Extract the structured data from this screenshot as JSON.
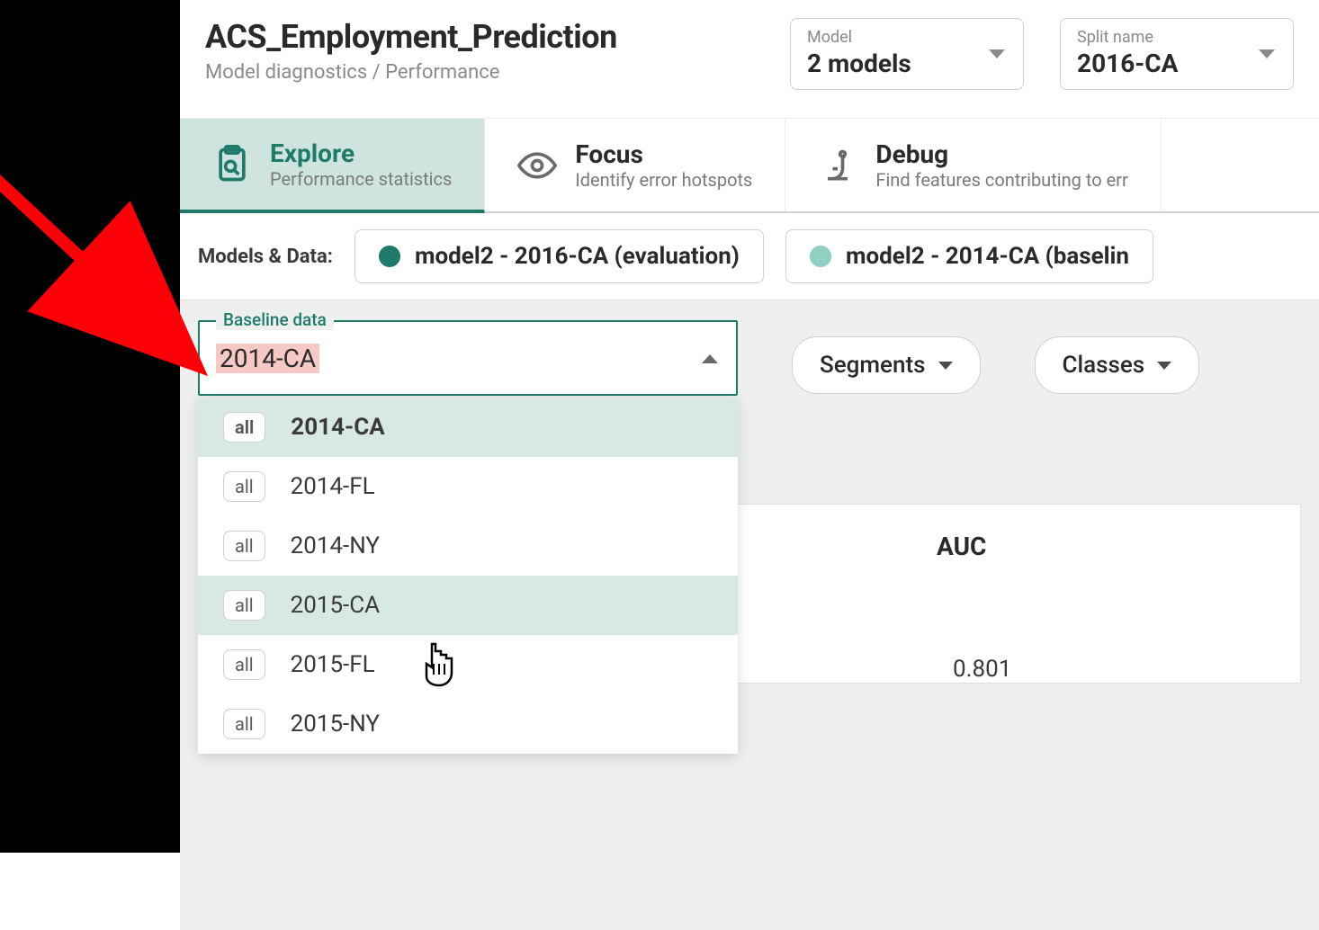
{
  "header": {
    "title": "ACS_Employment_Prediction",
    "breadcrumb": "Model diagnostics / Performance",
    "model_select": {
      "label": "Model",
      "value": "2 models"
    },
    "split_select": {
      "label": "Split name",
      "value": "2016-CA"
    }
  },
  "tabs": {
    "explore": {
      "title": "Explore",
      "sub": "Performance statistics"
    },
    "focus": {
      "title": "Focus",
      "sub": "Identify error hotspots"
    },
    "debug": {
      "title": "Debug",
      "sub": "Find features contributing to err"
    }
  },
  "models_row": {
    "label": "Models & Data:",
    "chip_eval": "model2 - 2016-CA (evaluation)",
    "chip_base": "model2 - 2014-CA (baselin"
  },
  "baseline": {
    "legend": "Baseline data",
    "value": "2014-CA",
    "options": [
      {
        "badge": "all",
        "label": "2014-CA",
        "selected": true
      },
      {
        "badge": "all",
        "label": "2014-FL",
        "selected": false
      },
      {
        "badge": "all",
        "label": "2014-NY",
        "selected": false
      },
      {
        "badge": "all",
        "label": "2015-CA",
        "selected": false,
        "hover": true
      },
      {
        "badge": "all",
        "label": "2015-FL",
        "selected": false
      },
      {
        "badge": "all",
        "label": "2015-NY",
        "selected": false
      }
    ]
  },
  "pills": {
    "segments": "Segments",
    "classes": "Classes"
  },
  "table": {
    "col_auc": "AUC",
    "val": "0.801"
  },
  "colors": {
    "accent": "#1f7a6a",
    "accent_light": "#8fd0c2",
    "highlight": "#f6c9c6",
    "arrow": "#fb0007"
  }
}
